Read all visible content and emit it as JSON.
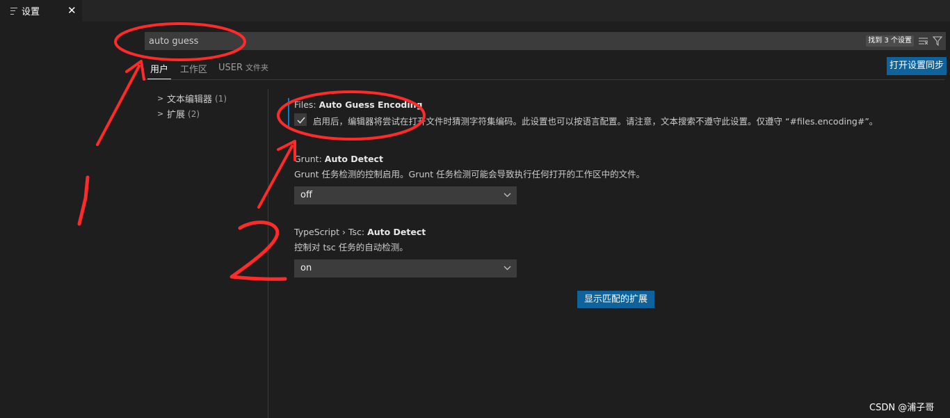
{
  "tab": {
    "title": "设置",
    "close": "✕",
    "icon": "settings-file-icon"
  },
  "search": {
    "value": "auto guess",
    "result_count": "找到 3 个设置",
    "clear_icon": "clear-filter-icon",
    "filter_icon": "filter-icon"
  },
  "scope_tabs": {
    "user": "用户",
    "workspace": "工作区",
    "user_upper": "USER",
    "folder": "文件夹"
  },
  "sync_button": "打开设置同步",
  "toc": [
    {
      "label": "文本编辑器",
      "count": "(1)"
    },
    {
      "label": "扩展",
      "count": "(2)"
    }
  ],
  "settings": [
    {
      "category": "Files: ",
      "name": "Auto Guess Encoding",
      "description": "启用后，编辑器将尝试在打开文件时猜测字符集编码。此设置也可以按语言配置。请注意，文本搜索不遵守此设置。仅遵守 “#files.encoding#”。",
      "checked": true
    },
    {
      "category": "Grunt: ",
      "name": "Auto Detect",
      "description": "Grunt 任务检测的控制启用。Grunt 任务检测可能会导致执行任何打开的工作区中的文件。",
      "value": "off"
    },
    {
      "category": "TypeScript › Tsc: ",
      "name": "Auto Detect",
      "description": "控制对 tsc 任务的自动检测。",
      "value": "on"
    }
  ],
  "show_extensions_button": "显示匹配的扩展",
  "watermark": "CSDN @浦子哥",
  "colors": {
    "accent": "#0e639c",
    "annotation": "#ff2a2a",
    "focus": "#007fd4"
  }
}
